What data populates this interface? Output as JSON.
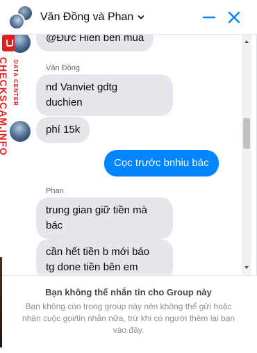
{
  "header": {
    "title": "Văn Đồng và Phan",
    "chevron_icon": "chevron-down-icon",
    "minimize_icon": "minimize-icon",
    "close_icon": "close-icon",
    "accent_color": "#0084ff"
  },
  "watermark": {
    "small_text": "DATA CENTER",
    "big_text": "CHECKSCAM.INFO",
    "color": "#e02020"
  },
  "messages": [
    {
      "id": "m1",
      "sender": "",
      "text": "@Đức Hiển bên mua",
      "direction": "in"
    },
    {
      "id": "m2",
      "sender": "Văn Đồng",
      "text": "nd Vanviet gdtg duchien",
      "direction": "in"
    },
    {
      "id": "m3",
      "sender": "",
      "text": "phí 15k",
      "direction": "in"
    },
    {
      "id": "m4",
      "sender": "",
      "text": "Cọc trước bnhiu bác",
      "direction": "out"
    },
    {
      "id": "m5",
      "sender": "Phan",
      "text": "trung gian giữ tiền mà bác",
      "direction": "in"
    },
    {
      "id": "m6",
      "sender": "",
      "text": "cần hết tiền b mới báo tg done tiền bên em",
      "direction": "in"
    }
  ],
  "message_lines": {
    "m1": [
      "@Đức Hiển bên mua"
    ],
    "m2": [
      "nd Vanviet gdtg",
      "duchien"
    ],
    "m3": [
      "phí 15k"
    ],
    "m4": [
      "Cọc trước bnhiu bác"
    ],
    "m5": [
      "trung gian giữ tiền mà",
      "bác"
    ],
    "m6": [
      "cần hết tiền b mới báo",
      "tg done tiền bên em"
    ]
  },
  "footer": {
    "title": "Bạn không thể nhắn tin cho Group này",
    "body": "Bạn không còn trong group này nên không thể gửi hoặc nhận cuộc gọi/tin nhắn nữa, trừ khi có người thêm lại bạn vào đây."
  }
}
